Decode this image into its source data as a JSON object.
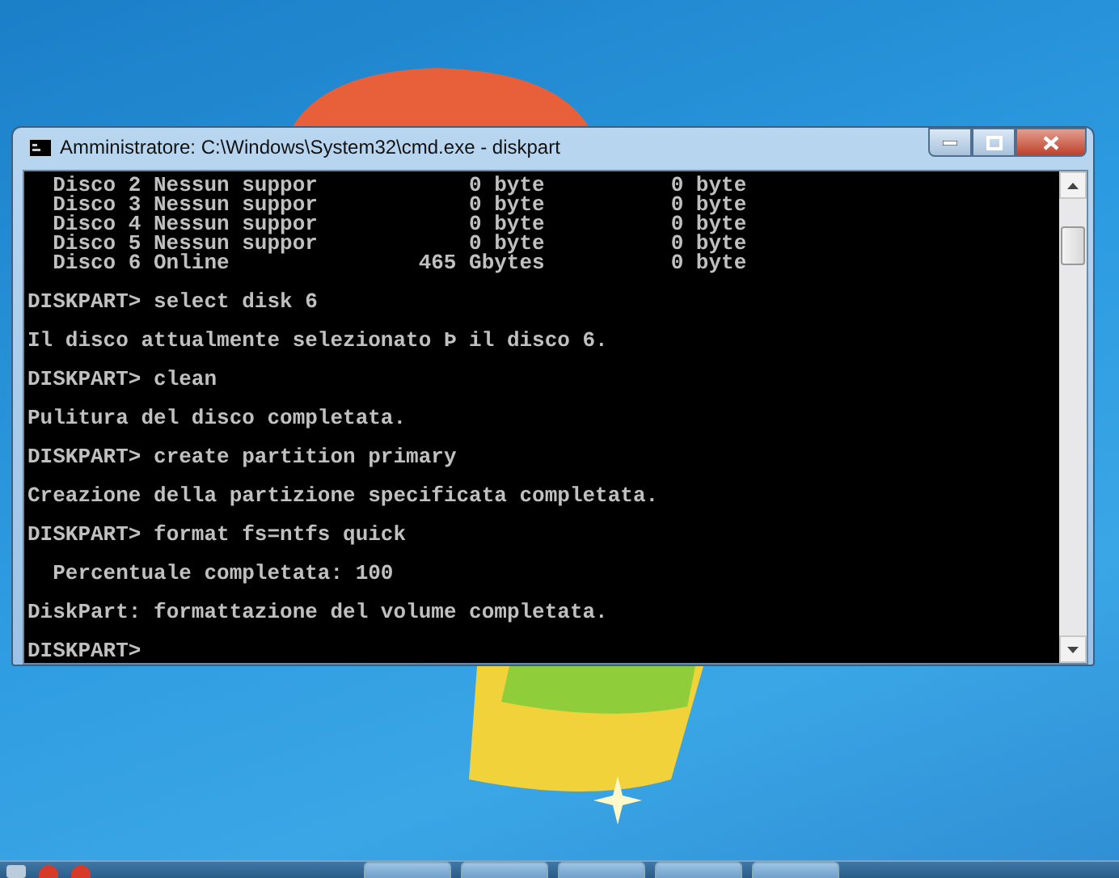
{
  "window": {
    "title": "Amministratore: C:\\Windows\\System32\\cmd.exe - diskpart"
  },
  "console": {
    "disk_rows": [
      {
        "disk": "Disco 2",
        "status": "Nessun suppor",
        "size": "0 byte",
        "free": "0 byte"
      },
      {
        "disk": "Disco 3",
        "status": "Nessun suppor",
        "size": "0 byte",
        "free": "0 byte"
      },
      {
        "disk": "Disco 4",
        "status": "Nessun suppor",
        "size": "0 byte",
        "free": "0 byte"
      },
      {
        "disk": "Disco 5",
        "status": "Nessun suppor",
        "size": "0 byte",
        "free": "0 byte"
      },
      {
        "disk": "Disco 6",
        "status": "Online",
        "size": "465 Gbytes",
        "free": "0 byte"
      }
    ],
    "lines": [
      "DISKPART> select disk 6",
      "Il disco attualmente selezionato Þ il disco 6.",
      "DISKPART> clean",
      "Pulitura del disco completata.",
      "DISKPART> create partition primary",
      "Creazione della partizione specificata completata.",
      "DISKPART> format fs=ntfs quick",
      "  Percentuale completata: 100",
      "DiskPart: formattazione del volume completata.",
      "DISKPART>"
    ]
  }
}
